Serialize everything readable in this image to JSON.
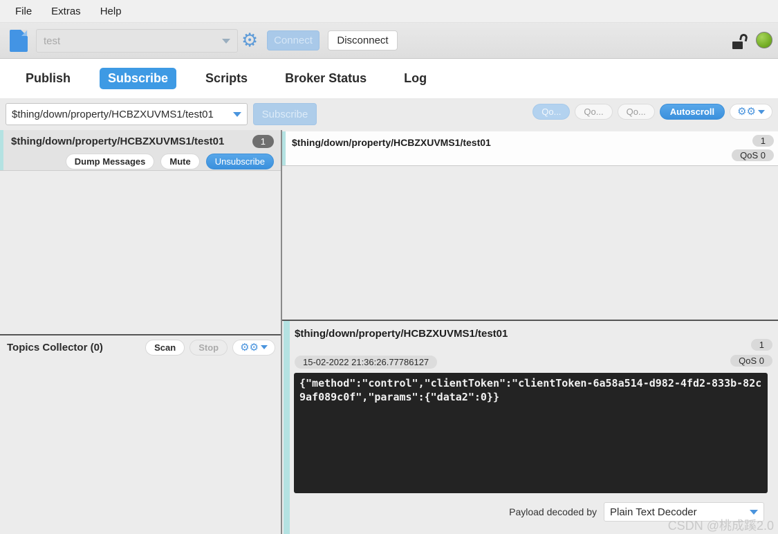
{
  "menu": {
    "items": [
      "File",
      "Extras",
      "Help"
    ]
  },
  "toolbar": {
    "connection_value": "test",
    "connect_label": "Connect",
    "disconnect_label": "Disconnect"
  },
  "tabs": {
    "items": [
      {
        "label": "Publish",
        "active": false
      },
      {
        "label": "Subscribe",
        "active": true
      },
      {
        "label": "Scripts",
        "active": false
      },
      {
        "label": "Broker Status",
        "active": false
      },
      {
        "label": "Log",
        "active": false
      }
    ]
  },
  "subscribe_bar": {
    "topic_value": "$thing/down/property/HCBZXUVMS1/test01",
    "subscribe_label": "Subscribe",
    "qos_buttons": [
      "Qo...",
      "Qo...",
      "Qo..."
    ],
    "autoscroll_label": "Autoscroll"
  },
  "subscription": {
    "topic": "$thing/down/property/HCBZXUVMS1/test01",
    "count": "1",
    "dump_label": "Dump Messages",
    "mute_label": "Mute",
    "unsubscribe_label": "Unsubscribe"
  },
  "topics_collector": {
    "title": "Topics Collector (0)",
    "scan_label": "Scan",
    "stop_label": "Stop"
  },
  "message_list": {
    "items": [
      {
        "topic": "$thing/down/property/HCBZXUVMS1/test01",
        "count": "1",
        "qos": "QoS 0"
      }
    ]
  },
  "message_detail": {
    "topic": "$thing/down/property/HCBZXUVMS1/test01",
    "count": "1",
    "timestamp": "15-02-2022 21:36:26.77786127",
    "qos": "QoS 0",
    "payload": "{\"method\":\"control\",\"clientToken\":\"clientToken-6a58a514-d982-4fd2-833b-82c9af089c0f\",\"params\":{\"data2\":0}}",
    "decoder_label": "Payload decoded by",
    "decoder_value": "Plain Text Decoder"
  },
  "watermark": "CSDN @桃成蹊2.0",
  "colors": {
    "accent_blue": "#3e9ae4",
    "disabled_blue": "#aecdea",
    "teal_strip": "#b4e2e2",
    "payload_bg": "#232323",
    "status_green": "#76af27",
    "badge_dark": "#6f6f6f",
    "badge_light": "#d9d9d9"
  }
}
